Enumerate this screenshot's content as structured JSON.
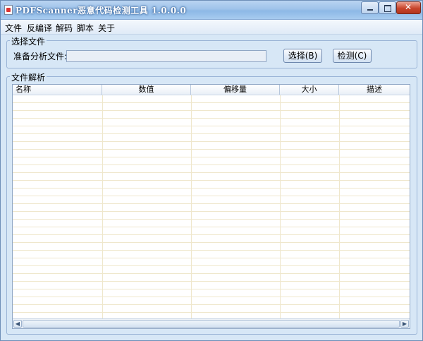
{
  "window": {
    "title": "PDFScanner恶意代码检测工具 1.0.0.0"
  },
  "menu": [
    "文件",
    "反编译",
    "解码",
    "脚本",
    "关于"
  ],
  "select_group": {
    "label": "选择文件",
    "file_label": "准备分析文件:",
    "path_value": "",
    "select_button": "选择(B)",
    "detect_button": "检测(C)"
  },
  "parse_group": {
    "label": "文件解析",
    "columns": [
      "名称",
      "数值",
      "偏移量",
      "大小",
      "描述"
    ]
  },
  "icons": {
    "app": "pdf-document-icon",
    "minimize": "minimize-icon",
    "maximize": "maximize-icon",
    "close": "close-icon",
    "scroll_left": "arrow-left-icon",
    "scroll_right": "arrow-right-icon"
  }
}
